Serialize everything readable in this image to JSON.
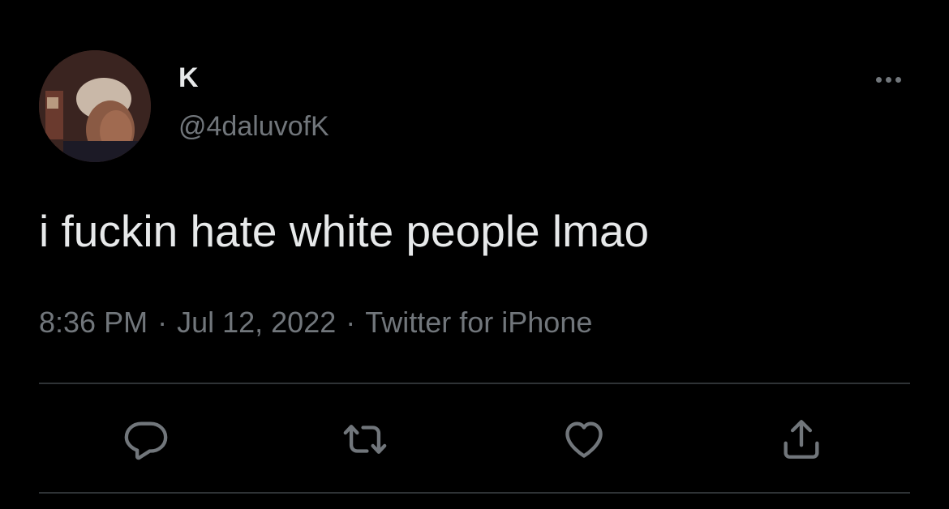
{
  "user": {
    "display_name": "K",
    "handle": "@4daluvofK"
  },
  "tweet": {
    "text": "i fuckin hate white people lmao",
    "time": "8:36 PM",
    "separator": "·",
    "date": "Jul 12, 2022",
    "source": "Twitter for iPhone"
  },
  "icons": {
    "more": "more-horizontal-icon",
    "reply": "reply-icon",
    "retweet": "retweet-icon",
    "like": "heart-icon",
    "share": "share-icon"
  },
  "colors": {
    "background": "#000000",
    "primary_text": "#e7e9ea",
    "secondary_text": "#71767b",
    "divider": "#2f3336"
  }
}
